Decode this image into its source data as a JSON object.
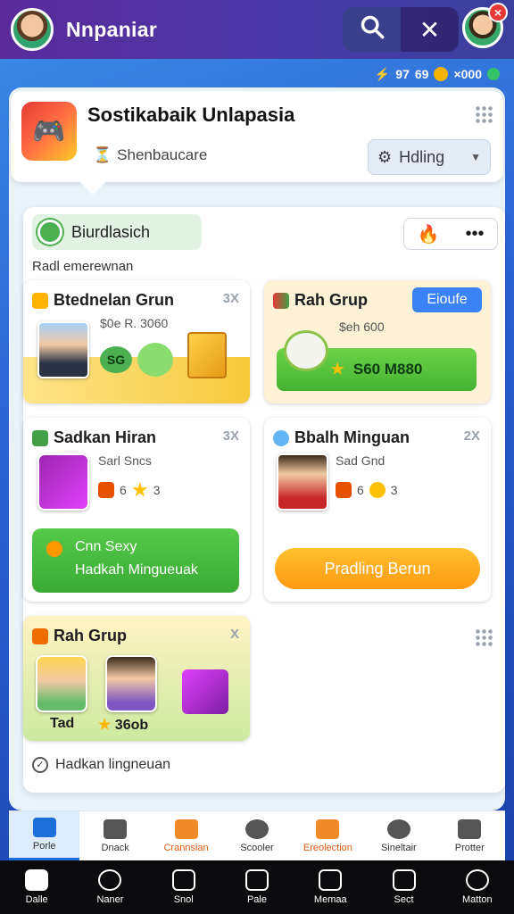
{
  "header": {
    "app_title": "Nnpaniar",
    "icons": [
      "search-icon",
      "close-icon"
    ]
  },
  "status": {
    "items": [
      "97",
      "69",
      "×000"
    ]
  },
  "banner": {
    "title": "Sostikabaik Unlapasia",
    "subtitle": "Shenbaucare",
    "sort_label": "Hdling"
  },
  "section": {
    "pill_label": "Biurdlasich",
    "label": "Radl emerewnan"
  },
  "cards": [
    {
      "title": "Btednelan Grun",
      "count": "3X",
      "subtitle": "$0e R. 3060",
      "badge": "SG"
    },
    {
      "title": "Rah Grup",
      "button": "Eioufe",
      "subtitle": "$eh 600",
      "bar_label": "S60 M880"
    },
    {
      "title": "Sadkan Hiran",
      "count": "3X",
      "subtitle": "Sarl Sncs",
      "badge_count": "6",
      "badge_value": "3",
      "band_title": "Cnn Sexy",
      "band_subtitle": "Hadkah Mingueuak"
    },
    {
      "title": "Bbalh Minguan",
      "count": "2X",
      "subtitle": "Sad Gnd",
      "badge_count": "6",
      "badge_value": "3",
      "button": "Pradling Berun"
    },
    {
      "title": "Rah Grup",
      "count": "X",
      "left_label": "Tad",
      "right_label": "36ob"
    }
  ],
  "footer_check": "Hadkan lingneuan",
  "tabs": [
    "Porle",
    "Dnack",
    "Crannsian",
    "Scooler",
    "Ereolection",
    "Sineltair",
    "Protter"
  ],
  "bottom_nav": [
    "Dalle",
    "Naner",
    "Snol",
    "Pale",
    "Memaa",
    "Sect",
    "Matton"
  ],
  "colors": {
    "topbar": "#5a2a9a",
    "accent_green": "#4caf50",
    "accent_orange": "#ff9a12",
    "accent_blue": "#3b82f6"
  }
}
